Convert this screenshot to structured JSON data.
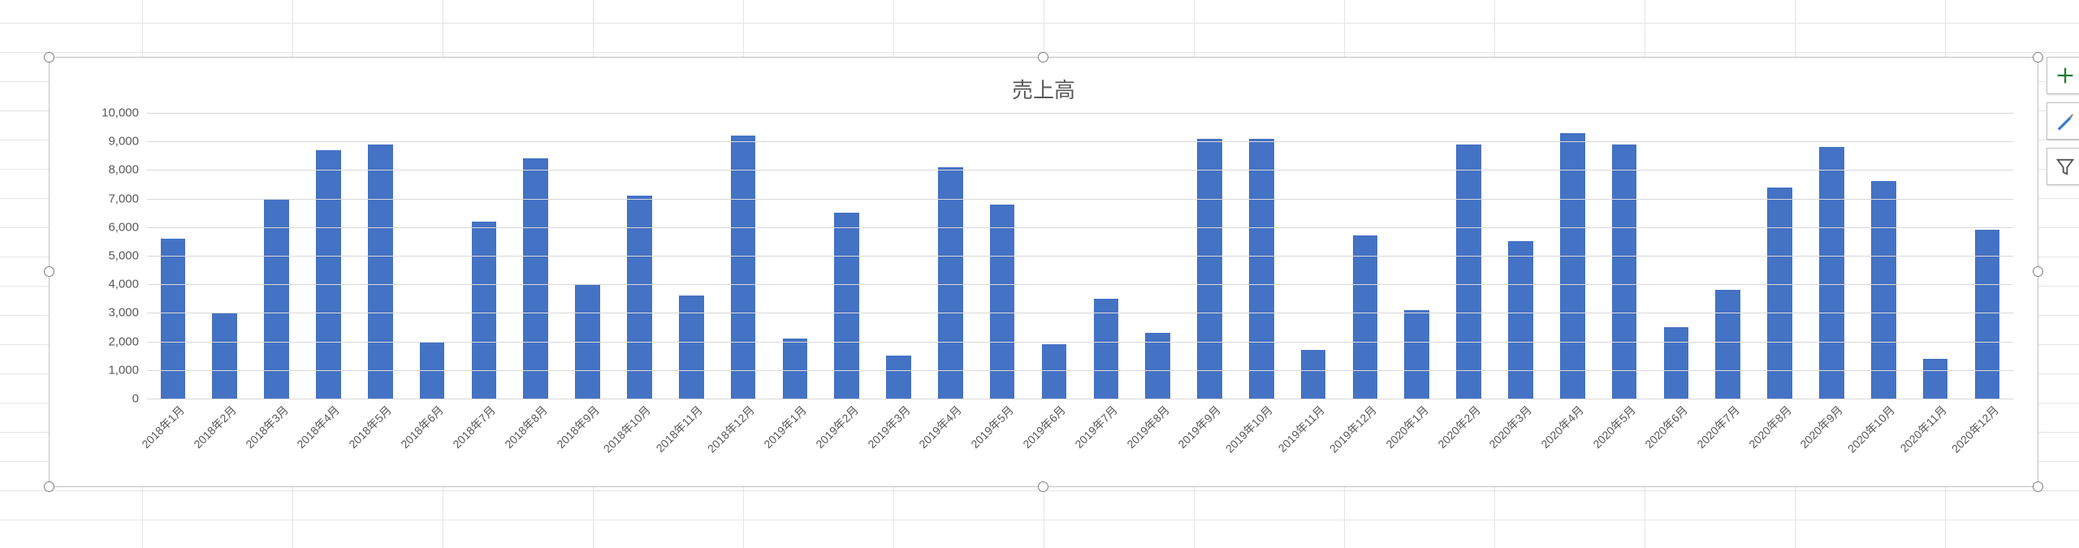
{
  "chart_data": {
    "type": "bar",
    "title": "売上高",
    "xlabel": "",
    "ylabel": "",
    "ylim": [
      0,
      10000
    ],
    "yticks": [
      0,
      1000,
      2000,
      3000,
      4000,
      5000,
      6000,
      7000,
      8000,
      9000,
      10000
    ],
    "ytick_labels": [
      "0",
      "1,000",
      "2,000",
      "3,000",
      "4,000",
      "5,000",
      "6,000",
      "7,000",
      "8,000",
      "9,000",
      "10,000"
    ],
    "categories": [
      "2018年1月",
      "2018年2月",
      "2018年3月",
      "2018年4月",
      "2018年5月",
      "2018年6月",
      "2018年7月",
      "2018年8月",
      "2018年9月",
      "2018年10月",
      "2018年11月",
      "2018年12月",
      "2019年1月",
      "2019年2月",
      "2019年3月",
      "2019年4月",
      "2019年5月",
      "2019年6月",
      "2019年7月",
      "2019年8月",
      "2019年9月",
      "2019年10月",
      "2019年11月",
      "2019年12月",
      "2020年1月",
      "2020年2月",
      "2020年3月",
      "2020年4月",
      "2020年5月",
      "2020年6月",
      "2020年7月",
      "2020年8月",
      "2020年9月",
      "2020年10月",
      "2020年11月",
      "2020年12月"
    ],
    "values": [
      5600,
      3000,
      7000,
      8700,
      8900,
      2000,
      6200,
      8400,
      4000,
      7100,
      3600,
      9200,
      2100,
      6500,
      1500,
      8100,
      6800,
      1900,
      3500,
      2300,
      9100,
      9100,
      1700,
      5700,
      3100,
      8900,
      5500,
      9300,
      8900,
      2500,
      3800,
      7400,
      8800,
      7600,
      1400,
      5900
    ],
    "series_color": "#4472c4",
    "grid": true
  },
  "side_buttons": {
    "elements_tooltip": "Chart Elements",
    "styles_tooltip": "Chart Styles",
    "filters_tooltip": "Chart Filters"
  }
}
